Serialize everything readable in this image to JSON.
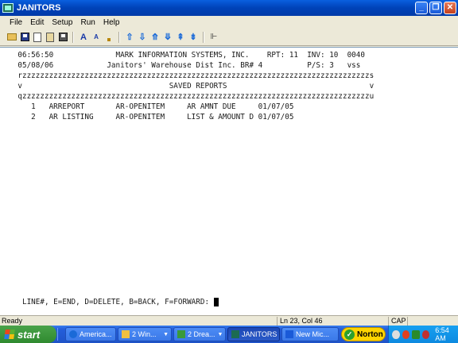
{
  "window": {
    "title": "JANITORS",
    "minimize_glyph": "_",
    "maximize_glyph": "❐",
    "close_glyph": "✕"
  },
  "menu": [
    "File",
    "Edit",
    "Setup",
    "Run",
    "Help"
  ],
  "toolbar": {
    "icons": [
      "open-folder-icon",
      "save-disk-icon",
      "copy-icon",
      "paste-icon",
      "print-icon",
      "font-larger-icon",
      "font-smaller-icon",
      "small-square-icon",
      "arrow-up-icon",
      "arrow-down-icon",
      "arrow-up-double-icon",
      "arrow-down-double-icon",
      "arrow-top-icon",
      "arrow-bottom-icon",
      "send-icon"
    ]
  },
  "terminal": {
    "lines": [
      "    06:56:50              MARK INFORMATION SYSTEMS, INC.    RPT: 11  INV: 10  0040",
      "    05/08/06            Janitors' Warehouse Dist Inc. BR# 4          P/S: 3   vss",
      "    rzzzzzzzzzzzzzzzzzzzzzzzzzzzzzzzzzzzzzzzzzzzzzzzzzzzzzzzzzzzzzzzzzzzzzzzzzzzzzzs",
      "    v                                 SAVED REPORTS                                v",
      "    qzzzzzzzzzzzzzzzzzzzzzzzzzzzzzzzzzzzzzzzzzzzzzzzzzzzzzzzzzzzzzzzzzzzzzzzzzzzzzzu",
      "       1   ARREPORT       AR-OPENITEM     AR AMNT DUE     01/07/05",
      "       2   AR LISTING     AR-OPENITEM     LIST & AMOUNT D 01/07/05"
    ],
    "prompt": "     LINE#, E=END, D=DELETE, B=BACK, F=FORWARD: "
  },
  "statusbar": {
    "status": "Ready",
    "position": "Ln 23, Col 46",
    "caps": "CAP"
  },
  "taskbar": {
    "start_label": "start",
    "buttons": [
      {
        "label": "America...",
        "icon_color": "#1a6ad8",
        "caret": ""
      },
      {
        "label": "2 Win...",
        "icon_color": "#f0c040",
        "caret": "▼"
      },
      {
        "label": "2 Drea...",
        "icon_color": "#3a9a3a",
        "caret": "▼"
      },
      {
        "label": "JANITORS",
        "icon_color": "#1c6b52",
        "caret": ""
      },
      {
        "label": "New Mic...",
        "icon_color": "#1a5ad8",
        "caret": ""
      }
    ],
    "norton_label": "Norton",
    "clock": "6:54 AM"
  }
}
